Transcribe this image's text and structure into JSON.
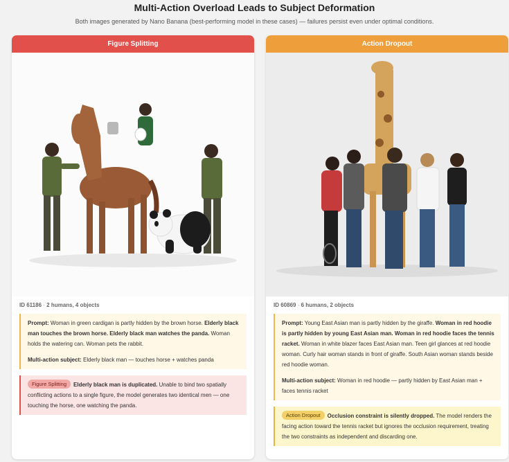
{
  "header": {
    "title": "Multi-Action Overload Leads to Subject Deformation",
    "subtitle": "Both images generated by Nano Banana (best-performing model in these cases) — failures persist even under optimal conditions."
  },
  "cards": [
    {
      "title": "Figure Splitting",
      "meta_id": "ID 61186",
      "meta_sep": " · ",
      "meta_counts": "2 humans, 4 objects",
      "prompt_label": "Prompt:",
      "prompt_plain_1": " Woman in green cardigan is partly hidden by the brown horse. ",
      "prompt_bold": "Elderly black man touches the brown horse. Elderly black man watches the panda.",
      "prompt_plain_2": " Woman holds the watering can. Woman pets the rabbit.",
      "multi_label": "Multi-action subject:",
      "multi_text": " Elderly black man — touches horse + watches panda",
      "badge": "Figure Splitting",
      "outcome_head": "Elderly black man is duplicated.",
      "outcome_text": " Unable to bind two spatially conflicting actions to a single figure, the model generates two identical men — one touching the horse, one watching the panda."
    },
    {
      "title": "Action Dropout",
      "meta_id": "ID 60869",
      "meta_sep": " · ",
      "meta_counts": "6 humans, 2 objects",
      "prompt_label": "Prompt:",
      "prompt_plain_1": " Young East Asian man is partly hidden by the giraffe. ",
      "prompt_bold": "Woman in red hoodie is partly hidden by young East Asian man. Woman in red hoodie faces the tennis racket.",
      "prompt_plain_2": " Woman in white blazer faces East Asian man. Teen girl glances at red hoodie woman. Curly hair woman stands in front of giraffe. South Asian woman stands beside red hoodie woman.",
      "multi_label": "Multi-action subject:",
      "multi_text": " Woman in red hoodie — partly hidden by East Asian man + faces tennis racket",
      "badge": "Action Dropout",
      "outcome_head": "Occlusion constraint is silently dropped.",
      "outcome_text": " The model renders the facing action toward the tennis racket but ignores the occlusion requirement, treating the two constraints as independent and discarding one."
    }
  ],
  "colors": {
    "figure_splitting": "#e2504c",
    "action_dropout": "#ee9e3a"
  }
}
